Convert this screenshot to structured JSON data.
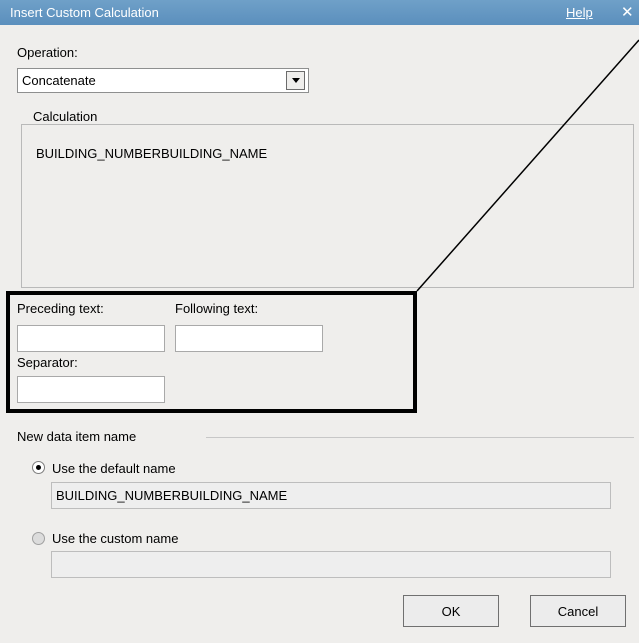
{
  "dialog": {
    "title": "Insert Custom Calculation",
    "help_label": "Help",
    "close_glyph": "✕"
  },
  "operation": {
    "label": "Operation:",
    "selected": "Concatenate"
  },
  "calculation": {
    "legend": "Calculation",
    "expression": "BUILDING_NUMBERBUILDING_NAME"
  },
  "text_options": {
    "preceding_label": "Preceding text:",
    "preceding_value": "",
    "following_label": "Following text:",
    "following_value": "",
    "separator_label": "Separator:",
    "separator_value": ""
  },
  "new_item": {
    "section_label": "New data item name",
    "default_radio_label": "Use the default name",
    "default_value": "BUILDING_NUMBERBUILDING_NAME",
    "custom_radio_label": "Use the custom name",
    "custom_value": ""
  },
  "buttons": {
    "ok": "OK",
    "cancel": "Cancel"
  }
}
